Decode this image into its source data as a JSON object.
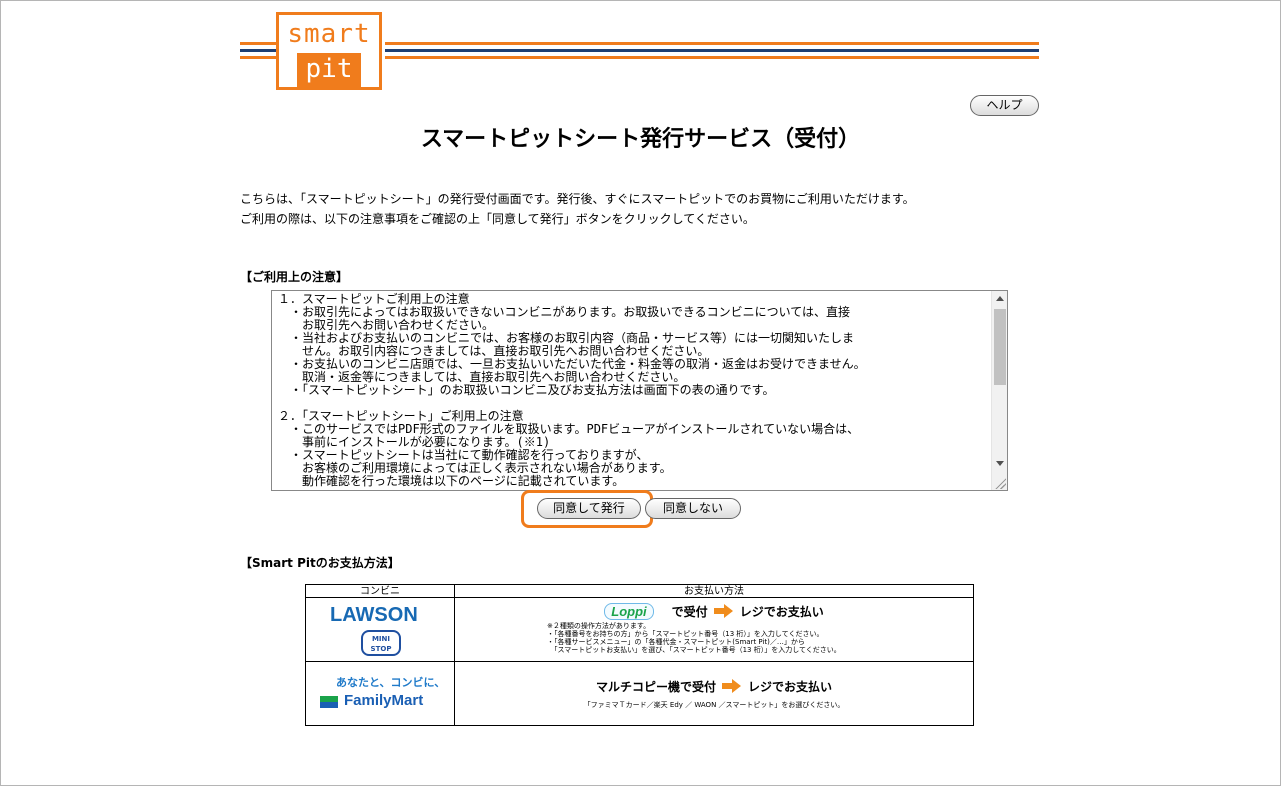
{
  "colors": {
    "accent": "#f07c1c",
    "header_stripe_dark": "#1e3f73",
    "header_stripe_orange": "#f07c1c"
  },
  "logo": {
    "line1": "smart",
    "line2": "pit"
  },
  "header": {
    "help_label": "ヘルプ"
  },
  "page_title": "スマートピットシート発行サービス（受付）",
  "intro": {
    "line1": "こちらは、「スマートピットシート」の発行受付画面です。発行後、すぐにスマートピットでのお買物にご利用いただけます。",
    "line2": "ご利用の際は、以下の注意事項をご確認の上「同意して発行」ボタンをクリックしてください。"
  },
  "notes": {
    "heading": "【ご利用上の注意】",
    "text": "１．スマートピットご利用上の注意\n　・お取引先によってはお取扱いできないコンビニがあります。お取扱いできるコンビニについては、直接\n　　お取引先へお問い合わせください。\n　・当社およびお支払いのコンビニでは、お客様のお取引内容（商品・サービス等）には一切関知いたしま\n　　せん。お取引内容につきましては、直接お取引先へお問い合わせください。\n　・お支払いのコンビニ店頭では、一旦お支払いいただいた代金・料金等の取消・返金はお受けできません。\n　　取消・返金等につきましては、直接お取引先へお問い合わせください。\n　・「スマートピットシート」のお取扱いコンビニ及びお支払方法は画面下の表の通りです。\n\n２．「スマートピットシート」ご利用上の注意\n　・このサービスではPDF形式のファイルを取扱います。PDFビューアがインストールされていない場合は、\n　　事前にインストールが必要になります。(※1)\n　・スマートピットシートは当社にて動作確認を行っておりますが、\n　　お客様のご利用環境によっては正しく表示されない場合があります。\n　　動作確認を行った環境は以下のページに記載されています。"
  },
  "buttons": {
    "agree": "同意して発行",
    "disagree": "同意しない"
  },
  "payment": {
    "heading": "【Smart Pitのお支払方法】",
    "col_store": "コンビニ",
    "col_method": "お支払い方法",
    "rows": [
      {
        "store_logo": "LAWSON",
        "store_logo2": "MINI STOP",
        "machine": "Loppi",
        "step1": "で受付",
        "step2": "レジでお支払い",
        "notes": "※２種類の操作方法があります。\n・「各種番号をお持ちの方」から「スマートピット番号（13 桁）」を入力してください。\n・「各種サービスメニュー」の「各種代金・スマートピット(Smart Pit)／…」から\n　「スマートピットお支払い」を選び、「スマートピット番号（13 桁）」を入力してください。"
      },
      {
        "store_tagline": "あなたと、コンビに、",
        "store_logo": "FamilyMart",
        "step1": "マルチコピー機で受付",
        "step2": "レジでお支払い",
        "notes": "「ファミマＴカード／楽天 Edy ／ WAON ／スマートピット」をお選びください。"
      }
    ]
  }
}
